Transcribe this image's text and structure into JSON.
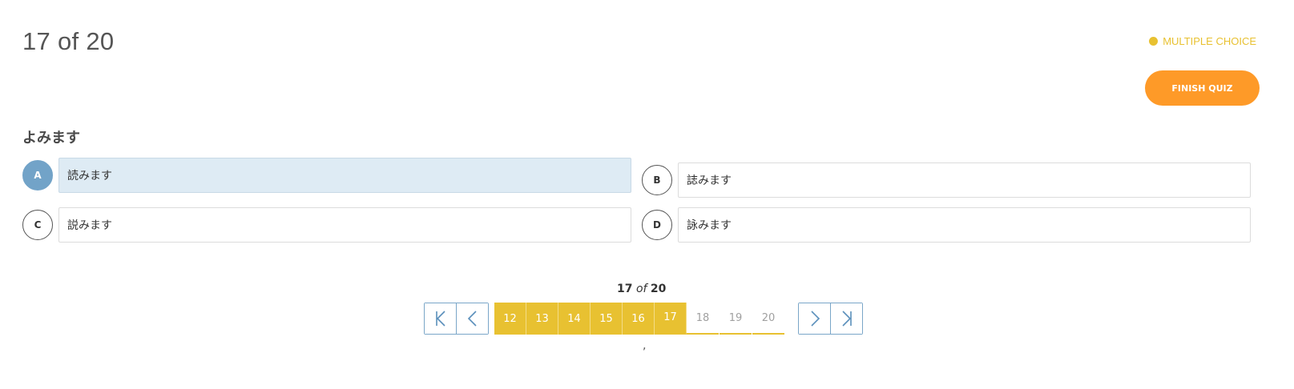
{
  "header": {
    "counter": "17 of 20",
    "question_type": "MULTIPLE CHOICE",
    "finish_label": "FINISH QUIZ"
  },
  "question": {
    "text": "よみます",
    "options": [
      {
        "letter": "A",
        "text": "読みます",
        "selected": true
      },
      {
        "letter": "B",
        "text": "誌みます",
        "selected": false
      },
      {
        "letter": "C",
        "text": "説みます",
        "selected": false
      },
      {
        "letter": "D",
        "text": "詠みます",
        "selected": false
      }
    ]
  },
  "pager": {
    "current": "17",
    "of": "of",
    "total": "20",
    "pages": [
      "12",
      "13",
      "14",
      "15",
      "16",
      "17",
      "18",
      "19",
      "20"
    ],
    "answered": [
      "12",
      "13",
      "14",
      "15",
      "16",
      "17"
    ],
    "footer_mark": ","
  },
  "colors": {
    "accent_yellow": "#e8c131",
    "finish_orange": "#fe9a28",
    "selected_blue": "#72a3c8",
    "selected_bg": "#deebf4",
    "nav_border": "#7aa6c8"
  },
  "icons": {
    "first": "first-page-icon",
    "prev": "chevron-left-icon",
    "next": "chevron-right-icon",
    "last": "last-page-icon"
  }
}
